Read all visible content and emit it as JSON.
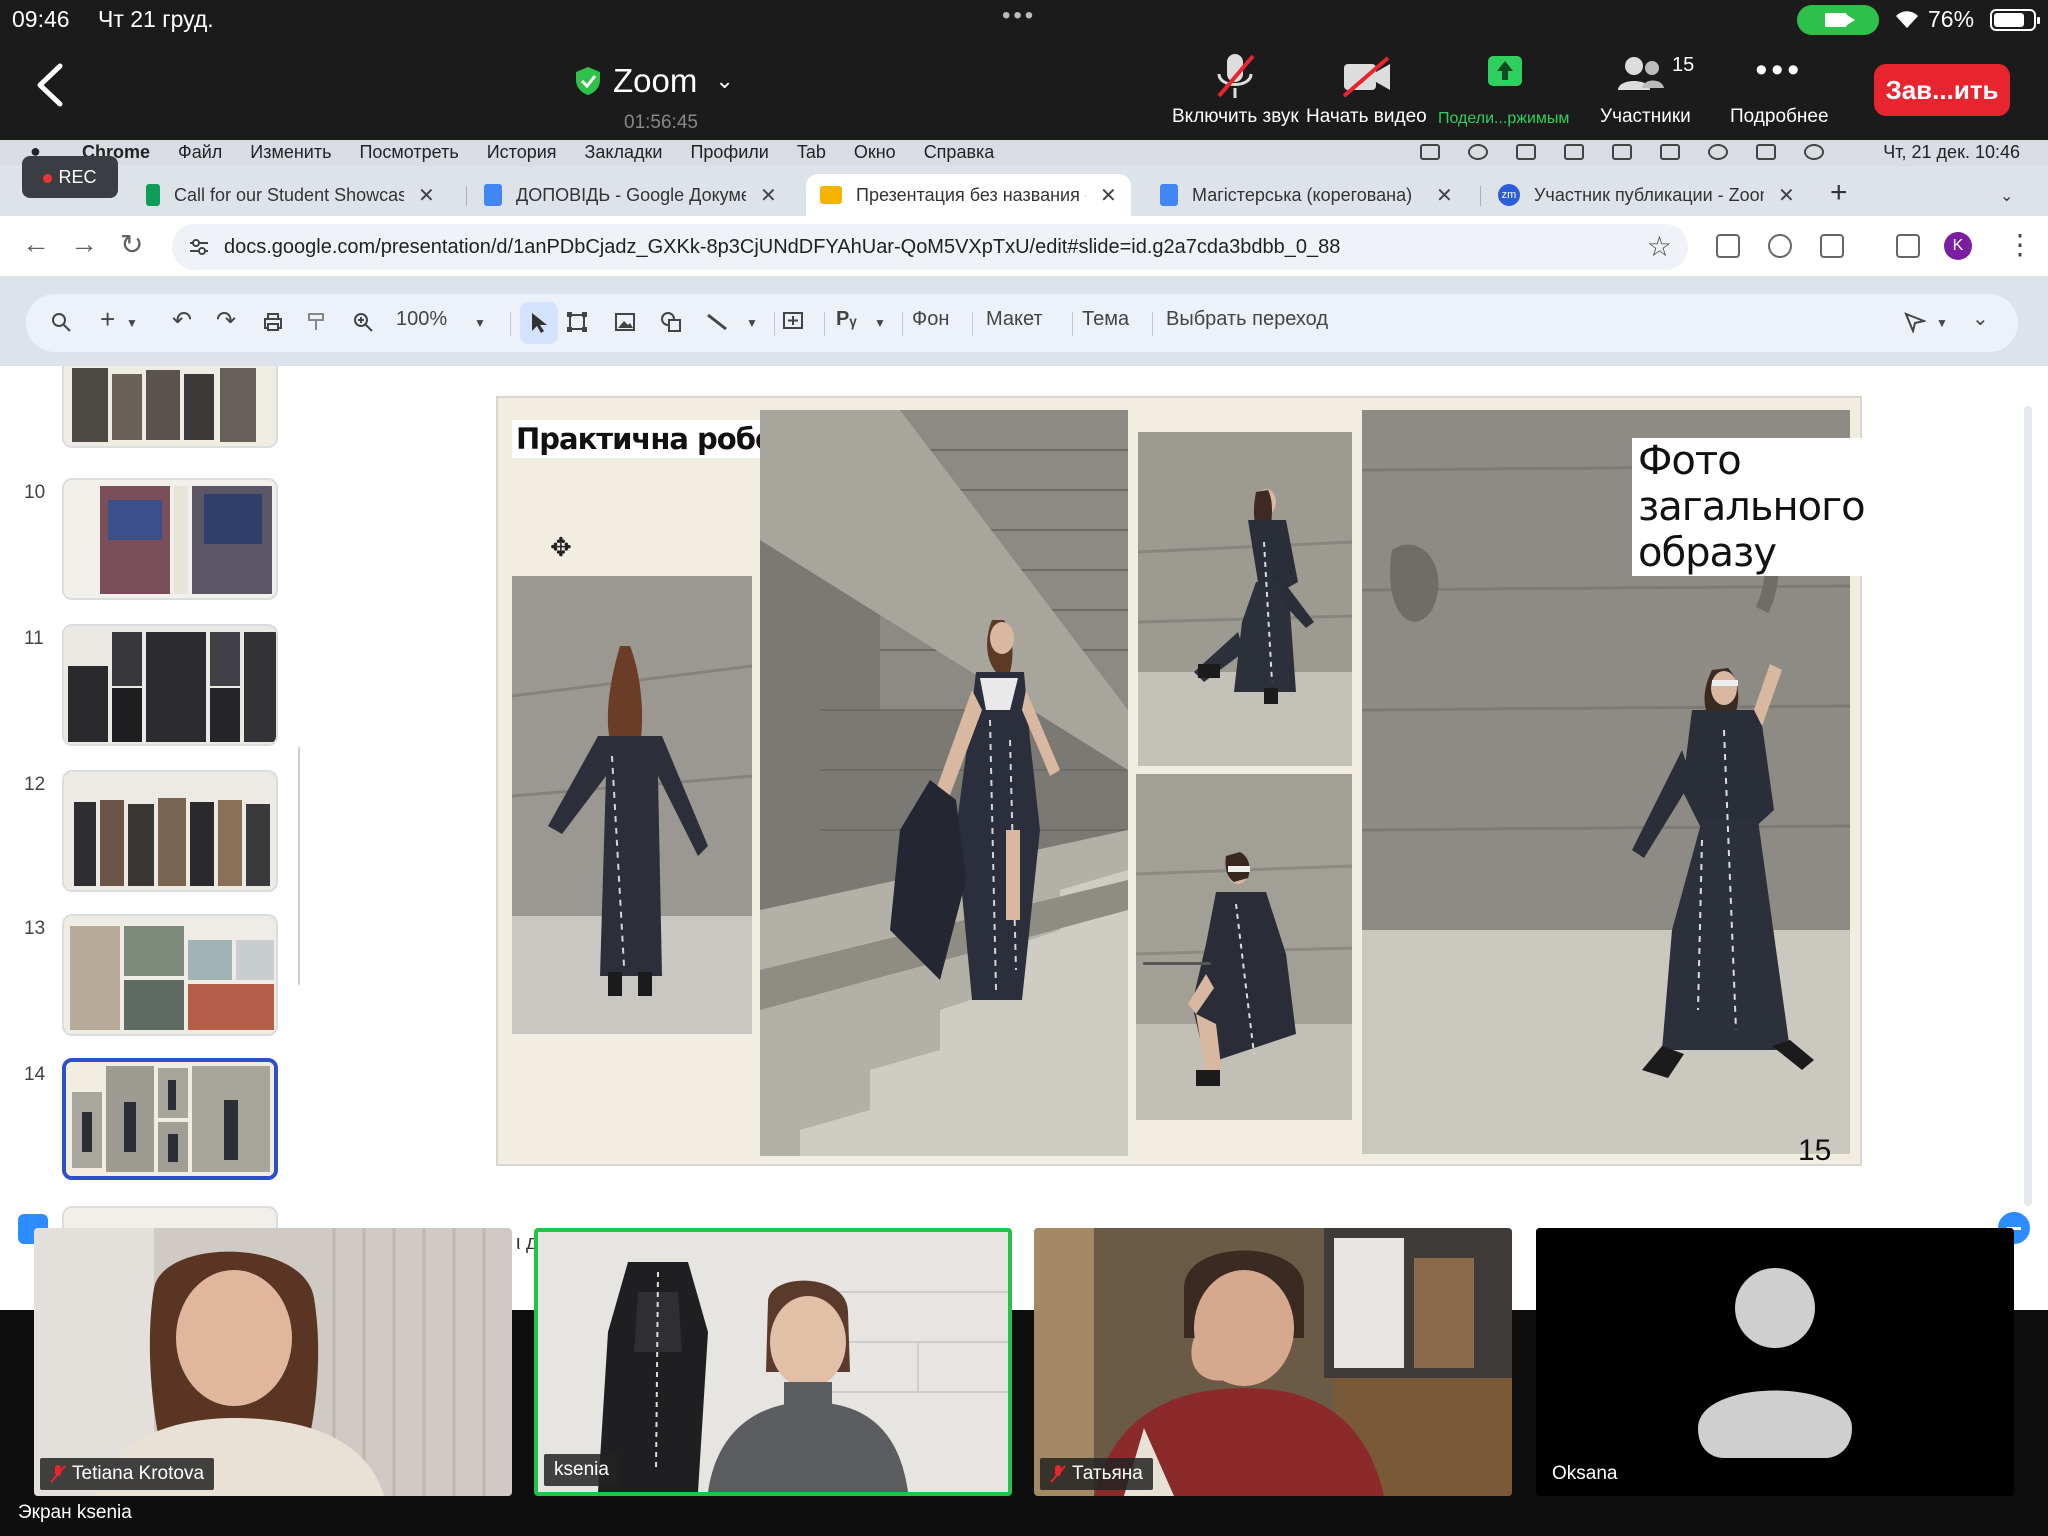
{
  "ios_status": {
    "time": "09:46",
    "date": "Чт 21 груд.",
    "battery": "76%"
  },
  "zoom": {
    "app_title": "Zoom",
    "timer": "01:56:45",
    "tools": [
      {
        "label": "Включить звук",
        "icon": "mic-muted-icon"
      },
      {
        "label": "Начать видео",
        "icon": "video-off-icon"
      },
      {
        "label": "Подели...ржимым",
        "icon": "share-screen-icon"
      },
      {
        "label": "Участники",
        "icon": "participants-icon",
        "count": "15"
      },
      {
        "label": "Подробнее",
        "icon": "more-icon"
      }
    ],
    "end_label": "Зав...ить",
    "screen_owner_label": "Экран ksenia"
  },
  "mac_menubar": {
    "items": [
      "Chrome",
      "Файл",
      "Изменить",
      "Посмотреть",
      "История",
      "Закладки",
      "Профили",
      "Tab",
      "Окно",
      "Справка"
    ],
    "clock": "Чт, 21 дек. 10:46"
  },
  "recording_label": "REC",
  "browser": {
    "tabs": [
      {
        "title": "Call for our Student Showcase",
        "favicon_color": "#0f9d58"
      },
      {
        "title": "ДОПОВІДЬ - Google Документы",
        "favicon_color": "#4285f4"
      },
      {
        "title": "Презентация без названия - Google",
        "favicon_color": "#f4b400"
      },
      {
        "title": "Магістерська (корегована)",
        "favicon_color": "#4285f4"
      },
      {
        "title": "Участник публикации - Zoom",
        "favicon_color": "#2d5dd8",
        "favicon_text": "zm"
      }
    ],
    "url": "docs.google.com/presentation/d/1anPDbCjadz_GXKk-8p3CjUNdDFYAhUar-QoM5VXpTxU/edit#slide=id.g2a7cda3bdbb_0_88",
    "profile_initial": "K"
  },
  "slides_toolbar": {
    "zoom": "100%",
    "buttons": [
      "Фон",
      "Макет",
      "Тема",
      "Выбрать переход"
    ]
  },
  "filmstrip": {
    "numbers": [
      "10",
      "11",
      "12",
      "13",
      "14"
    ]
  },
  "slide": {
    "title": "Практична робота",
    "caption": "Фото загального образу",
    "page_number": "15"
  },
  "stray_text": "ι д",
  "participants": [
    {
      "name": "Tetiana Krotova",
      "muted": true
    },
    {
      "name": "ksenia",
      "muted": false,
      "speaking": true
    },
    {
      "name": "Татьяна",
      "muted": true
    },
    {
      "name": "Oksana",
      "muted": false
    }
  ]
}
